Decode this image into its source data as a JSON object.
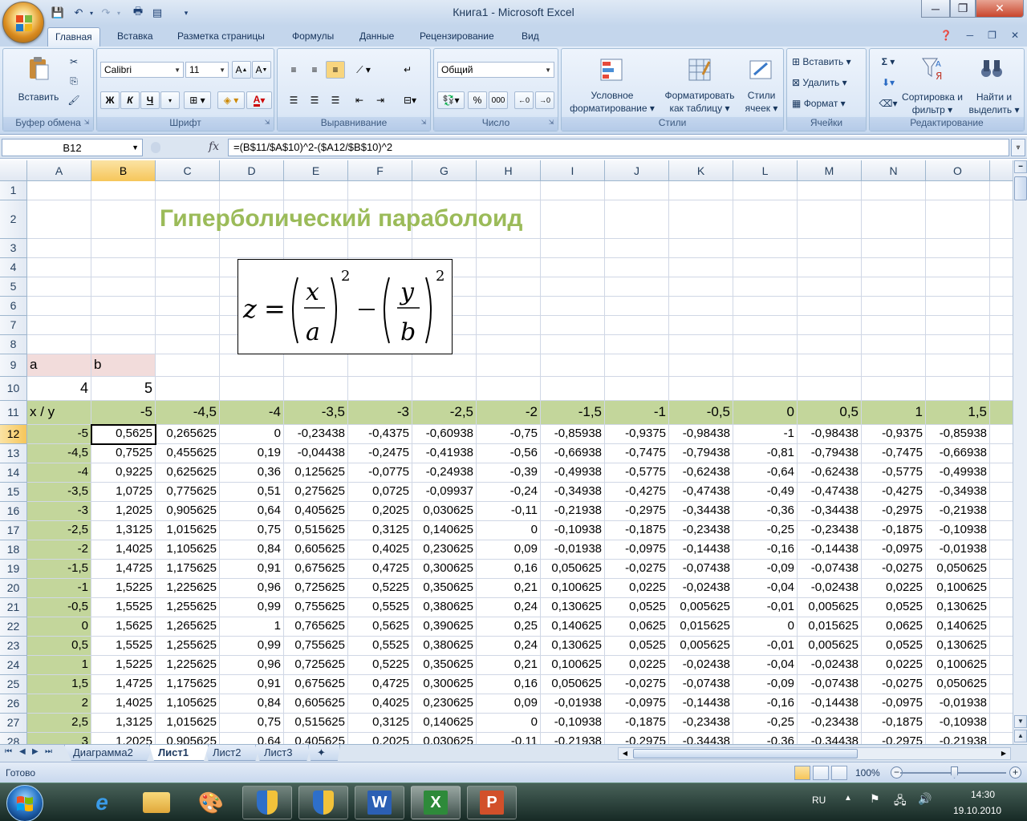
{
  "window": {
    "title": "Книга1 - Microsoft Excel",
    "minimize": "─",
    "restore": "❐",
    "close": "✕"
  },
  "ribbon_tabs": [
    "Главная",
    "Вставка",
    "Разметка страницы",
    "Формулы",
    "Данные",
    "Рецензирование",
    "Вид"
  ],
  "ribbon": {
    "clipboard": {
      "label": "Буфер обмена",
      "paste": "Вставить"
    },
    "font": {
      "label": "Шрифт",
      "font_name": "Calibri",
      "font_size": "11",
      "bold": "Ж",
      "italic": "К",
      "underline": "Ч"
    },
    "alignment": {
      "label": "Выравнивание"
    },
    "number": {
      "label": "Число",
      "format": "Общий",
      "percent": "%",
      "thousands": "000"
    },
    "styles": {
      "label": "Стили",
      "conditional": "Условное форматирование",
      "as_table": "Форматировать как таблицу",
      "cell_styles": "Стили ячеек"
    },
    "cells": {
      "label": "Ячейки",
      "insert": "Вставить",
      "delete": "Удалить",
      "format": "Формат"
    },
    "editing": {
      "label": "Редактирование",
      "sum": "Σ",
      "sort": "Сортировка и фильтр",
      "find": "Найти и выделить"
    }
  },
  "formula_bar": {
    "name_box": "B12",
    "fx": "fx",
    "formula": "=(B$11/$A$10)^2-($A12/$B$10)^2"
  },
  "columns": [
    "A",
    "B",
    "C",
    "D",
    "E",
    "F",
    "G",
    "H",
    "I",
    "J",
    "K",
    "L",
    "M",
    "N",
    "O"
  ],
  "selected_column": "B",
  "selected_row": 12,
  "sheet": {
    "title": "Гиперболический параболоид",
    "label_a": "a",
    "label_b": "b",
    "value_a": "4",
    "value_b": "5",
    "corner_label": "x / y",
    "x_header": [
      "-5",
      "-4,5",
      "-4",
      "-3,5",
      "-3",
      "-2,5",
      "-2",
      "-1,5",
      "-1",
      "-0,5",
      "0",
      "0,5",
      "1",
      "1,5"
    ],
    "rows": [
      {
        "y": "-5",
        "v": [
          "0,5625",
          "0,265625",
          "0",
          "-0,23438",
          "-0,4375",
          "-0,60938",
          "-0,75",
          "-0,85938",
          "-0,9375",
          "-0,98438",
          "-1",
          "-0,98438",
          "-0,9375",
          "-0,85938"
        ]
      },
      {
        "y": "-4,5",
        "v": [
          "0,7525",
          "0,455625",
          "0,19",
          "-0,04438",
          "-0,2475",
          "-0,41938",
          "-0,56",
          "-0,66938",
          "-0,7475",
          "-0,79438",
          "-0,81",
          "-0,79438",
          "-0,7475",
          "-0,66938"
        ]
      },
      {
        "y": "-4",
        "v": [
          "0,9225",
          "0,625625",
          "0,36",
          "0,125625",
          "-0,0775",
          "-0,24938",
          "-0,39",
          "-0,49938",
          "-0,5775",
          "-0,62438",
          "-0,64",
          "-0,62438",
          "-0,5775",
          "-0,49938"
        ]
      },
      {
        "y": "-3,5",
        "v": [
          "1,0725",
          "0,775625",
          "0,51",
          "0,275625",
          "0,0725",
          "-0,09937",
          "-0,24",
          "-0,34938",
          "-0,4275",
          "-0,47438",
          "-0,49",
          "-0,47438",
          "-0,4275",
          "-0,34938"
        ]
      },
      {
        "y": "-3",
        "v": [
          "1,2025",
          "0,905625",
          "0,64",
          "0,405625",
          "0,2025",
          "0,030625",
          "-0,11",
          "-0,21938",
          "-0,2975",
          "-0,34438",
          "-0,36",
          "-0,34438",
          "-0,2975",
          "-0,21938"
        ]
      },
      {
        "y": "-2,5",
        "v": [
          "1,3125",
          "1,015625",
          "0,75",
          "0,515625",
          "0,3125",
          "0,140625",
          "0",
          "-0,10938",
          "-0,1875",
          "-0,23438",
          "-0,25",
          "-0,23438",
          "-0,1875",
          "-0,10938"
        ]
      },
      {
        "y": "-2",
        "v": [
          "1,4025",
          "1,105625",
          "0,84",
          "0,605625",
          "0,4025",
          "0,230625",
          "0,09",
          "-0,01938",
          "-0,0975",
          "-0,14438",
          "-0,16",
          "-0,14438",
          "-0,0975",
          "-0,01938"
        ]
      },
      {
        "y": "-1,5",
        "v": [
          "1,4725",
          "1,175625",
          "0,91",
          "0,675625",
          "0,4725",
          "0,300625",
          "0,16",
          "0,050625",
          "-0,0275",
          "-0,07438",
          "-0,09",
          "-0,07438",
          "-0,0275",
          "0,050625"
        ]
      },
      {
        "y": "-1",
        "v": [
          "1,5225",
          "1,225625",
          "0,96",
          "0,725625",
          "0,5225",
          "0,350625",
          "0,21",
          "0,100625",
          "0,0225",
          "-0,02438",
          "-0,04",
          "-0,02438",
          "0,0225",
          "0,100625"
        ]
      },
      {
        "y": "-0,5",
        "v": [
          "1,5525",
          "1,255625",
          "0,99",
          "0,755625",
          "0,5525",
          "0,380625",
          "0,24",
          "0,130625",
          "0,0525",
          "0,005625",
          "-0,01",
          "0,005625",
          "0,0525",
          "0,130625"
        ]
      },
      {
        "y": "0",
        "v": [
          "1,5625",
          "1,265625",
          "1",
          "0,765625",
          "0,5625",
          "0,390625",
          "0,25",
          "0,140625",
          "0,0625",
          "0,015625",
          "0",
          "0,015625",
          "0,0625",
          "0,140625"
        ]
      },
      {
        "y": "0,5",
        "v": [
          "1,5525",
          "1,255625",
          "0,99",
          "0,755625",
          "0,5525",
          "0,380625",
          "0,24",
          "0,130625",
          "0,0525",
          "0,005625",
          "-0,01",
          "0,005625",
          "0,0525",
          "0,130625"
        ]
      },
      {
        "y": "1",
        "v": [
          "1,5225",
          "1,225625",
          "0,96",
          "0,725625",
          "0,5225",
          "0,350625",
          "0,21",
          "0,100625",
          "0,0225",
          "-0,02438",
          "-0,04",
          "-0,02438",
          "0,0225",
          "0,100625"
        ]
      },
      {
        "y": "1,5",
        "v": [
          "1,4725",
          "1,175625",
          "0,91",
          "0,675625",
          "0,4725",
          "0,300625",
          "0,16",
          "0,050625",
          "-0,0275",
          "-0,07438",
          "-0,09",
          "-0,07438",
          "-0,0275",
          "0,050625"
        ]
      },
      {
        "y": "2",
        "v": [
          "1,4025",
          "1,105625",
          "0,84",
          "0,605625",
          "0,4025",
          "0,230625",
          "0,09",
          "-0,01938",
          "-0,0975",
          "-0,14438",
          "-0,16",
          "-0,14438",
          "-0,0975",
          "-0,01938"
        ]
      },
      {
        "y": "2,5",
        "v": [
          "1,3125",
          "1,015625",
          "0,75",
          "0,515625",
          "0,3125",
          "0,140625",
          "0",
          "-0,10938",
          "-0,1875",
          "-0,23438",
          "-0,25",
          "-0,23438",
          "-0,1875",
          "-0,10938"
        ]
      },
      {
        "y": "3",
        "v": [
          "1,2025",
          "0,905625",
          "0,64",
          "0,405625",
          "0,2025",
          "0,030625",
          "-0,11",
          "-0,21938",
          "-0,2975",
          "-0,34438",
          "-0,36",
          "-0,34438",
          "-0,2975",
          "-0,21938"
        ]
      }
    ]
  },
  "sheet_tabs": [
    "Диаграмма2",
    "Лист1",
    "Лист2",
    "Лист3"
  ],
  "active_sheet": "Лист1",
  "status": {
    "text": "Готово",
    "zoom": "100%"
  },
  "taskbar": {
    "lang": "RU",
    "time": "14:30",
    "date": "19.10.2010"
  },
  "colors": {
    "title_green": "#9bbb59",
    "header_green": "#c3d69b",
    "label_pink": "#f2dcdb"
  }
}
